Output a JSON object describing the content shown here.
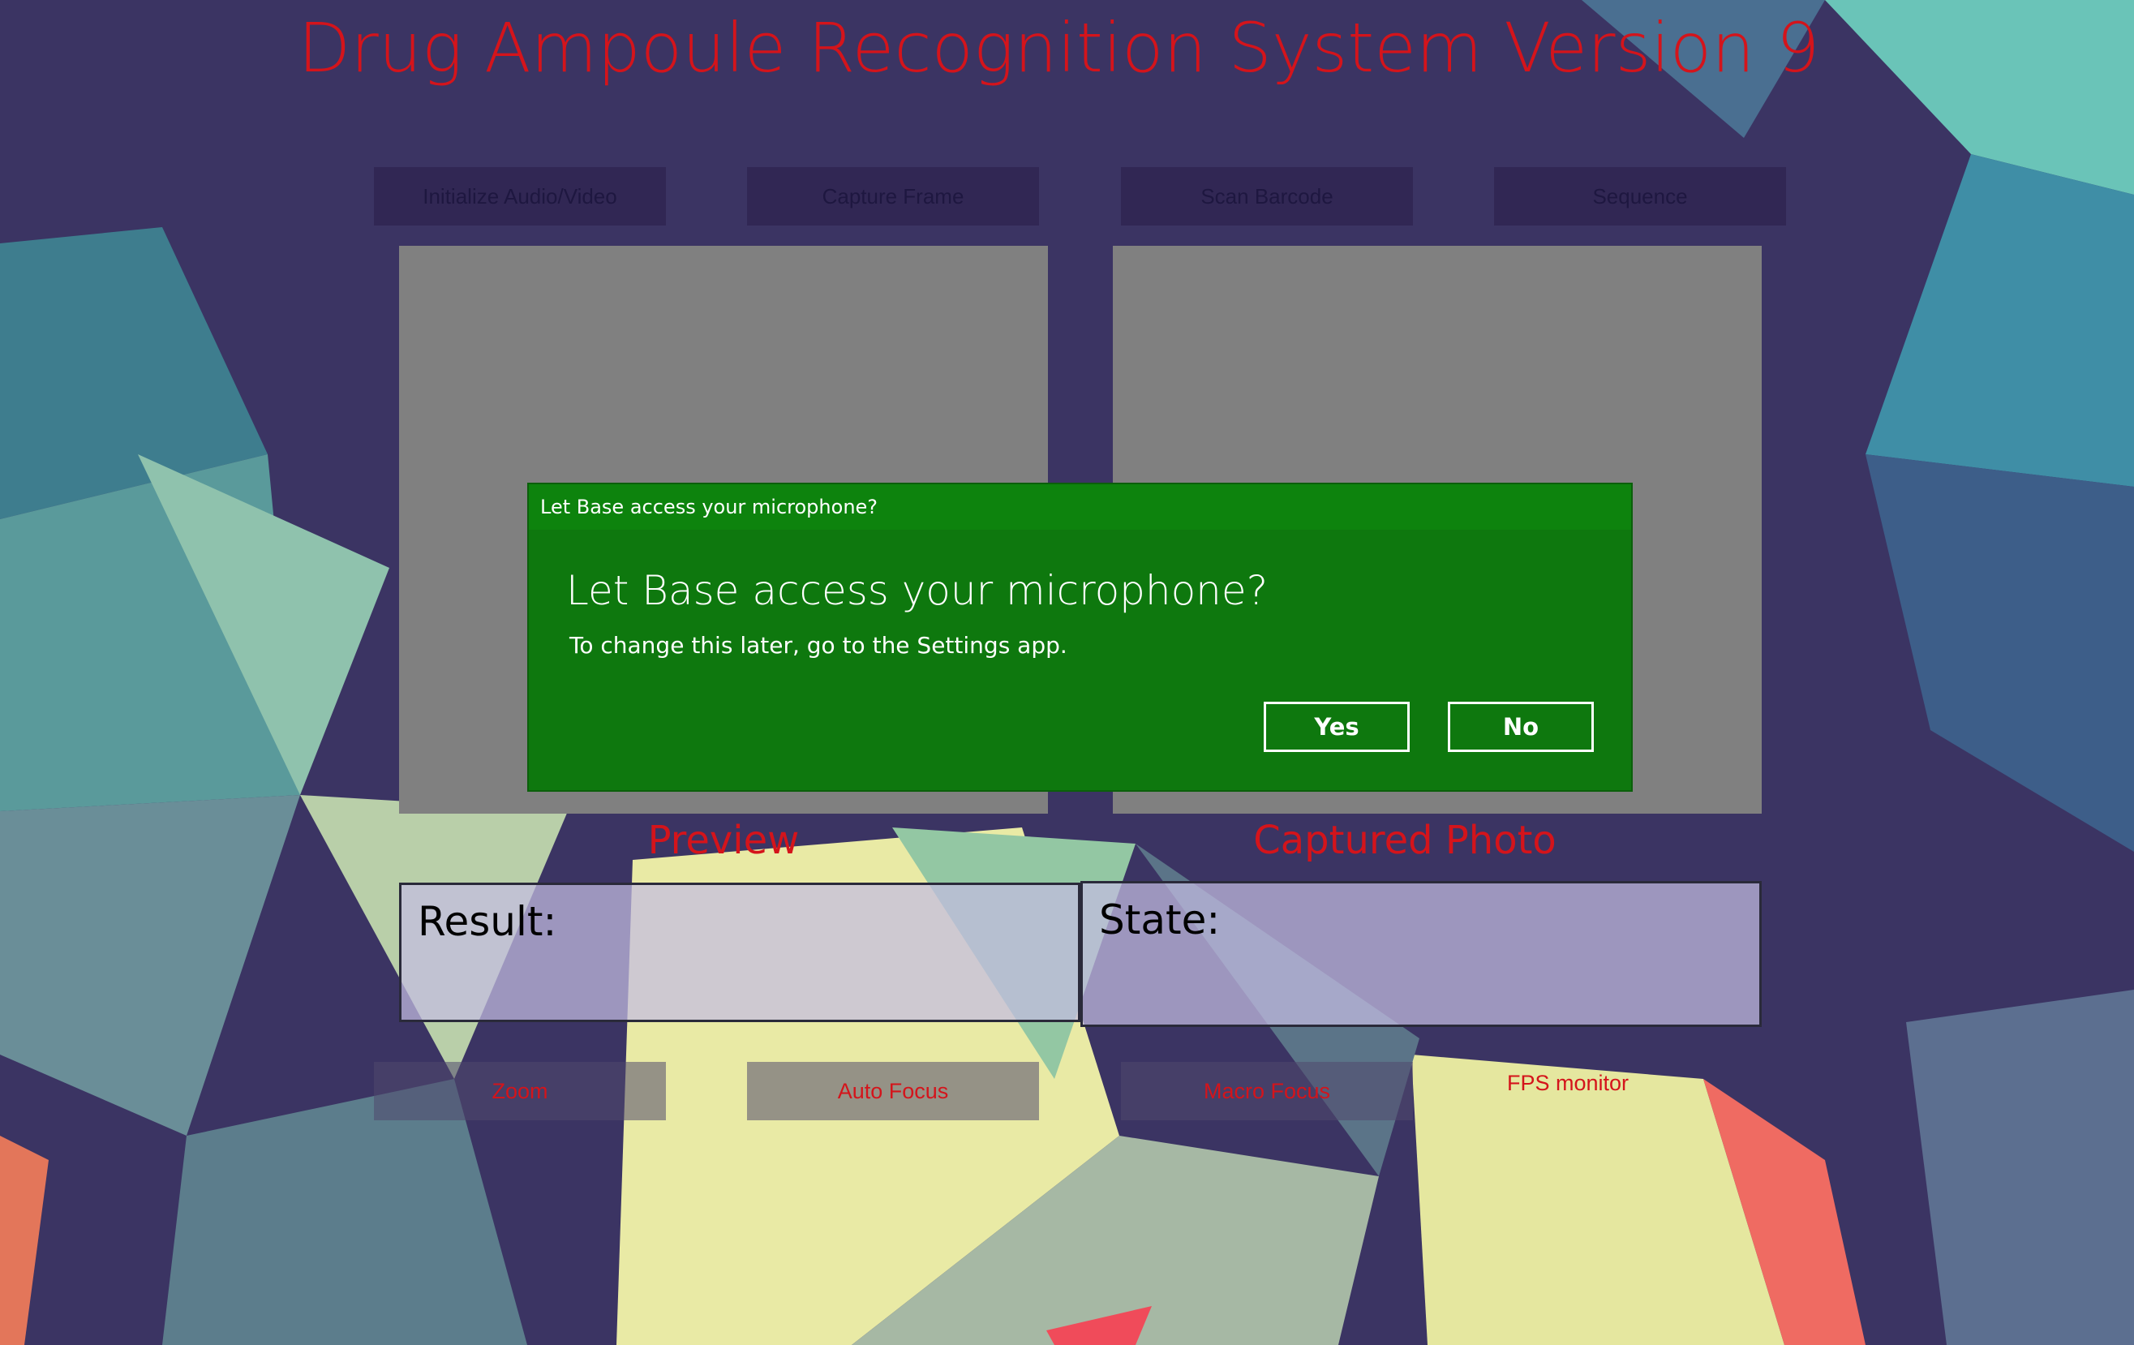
{
  "app": {
    "title": "Drug Ampoule Recognition System Version 9"
  },
  "toolbar": {
    "init_av": "Initialize Audio/Video",
    "capture_frame": "Capture Frame",
    "scan_barcode": "Scan Barcode",
    "sequence": "Sequence"
  },
  "panels": {
    "preview_caption": "Preview",
    "captured_caption": "Captured Photo"
  },
  "result": {
    "label": "Result:"
  },
  "state": {
    "label": "State:"
  },
  "bottom": {
    "zoom": "Zoom",
    "auto_focus": "Auto Focus",
    "macro_focus": "Macro Focus",
    "fps_monitor": "FPS monitor"
  },
  "dialog": {
    "titlebar": "Let Base access your microphone?",
    "heading": "Let Base access your microphone?",
    "message": "To change this later, go to the Settings app.",
    "yes": "Yes",
    "no": "No"
  },
  "colors": {
    "accent_red": "#d4141b",
    "dialog_green": "#0e780e",
    "panel_gray": "#808080"
  }
}
